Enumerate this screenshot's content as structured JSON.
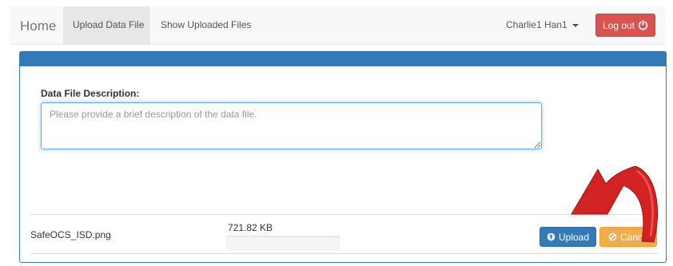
{
  "navbar": {
    "brand": "Home",
    "items": [
      {
        "label": "Upload Data File",
        "active": true
      },
      {
        "label": "Show Uploaded Files",
        "active": false
      }
    ],
    "user_label": "Charlie1 Han1",
    "logout_label": "Log out"
  },
  "form": {
    "description_label": "Data File Description:",
    "description_placeholder": "Please provide a brief description of the data file.",
    "description_value": ""
  },
  "file": {
    "name": "SafeOCS_ISD.png",
    "size": "721.82 KB",
    "progress_fraction": 0,
    "upload_label": "Upload",
    "cancel_label": "Cancel"
  },
  "colors": {
    "primary": "#337ab7",
    "danger": "#d9534f",
    "warning": "#f0ad4e",
    "annotation_arrow": "#d32222"
  },
  "icons": {
    "logout": "power-icon",
    "upload": "circle-arrow-up-icon",
    "cancel": "ban-icon",
    "user_menu": "caret-down-icon"
  }
}
